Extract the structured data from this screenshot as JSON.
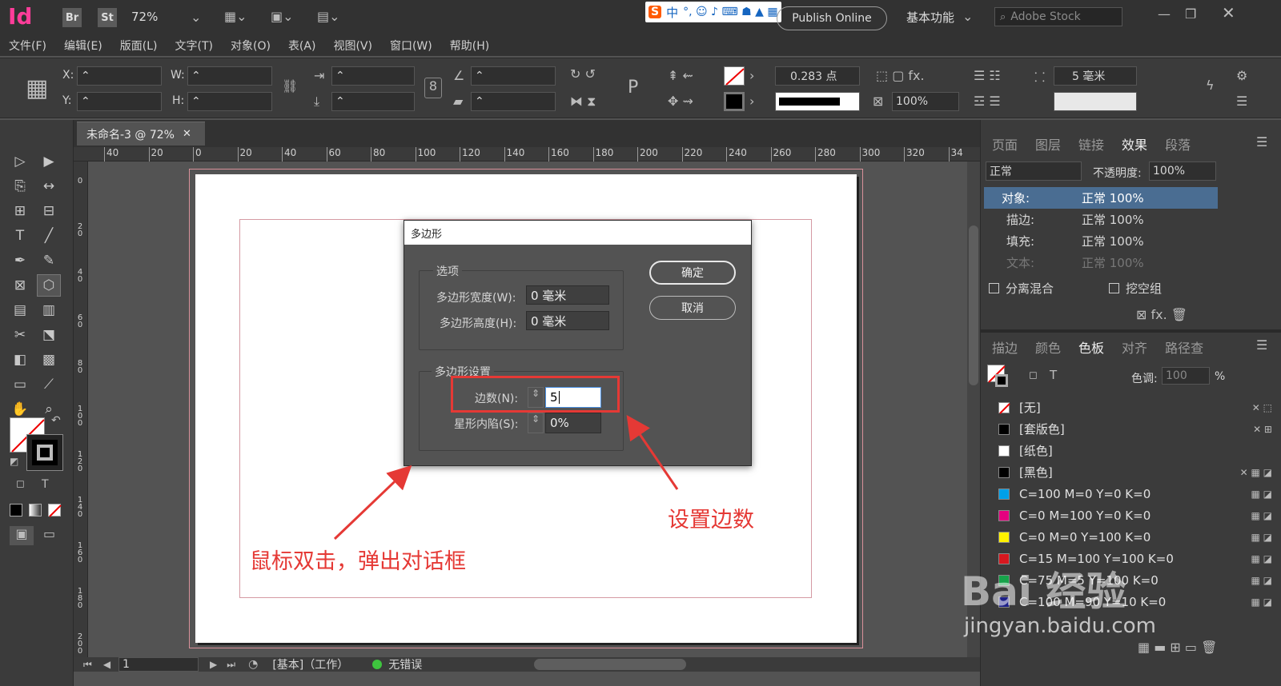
{
  "app": {
    "logo": "Id",
    "bridge": "Br",
    "stock_btn": "St",
    "zoom": "72%",
    "publish": "Publish Online",
    "workspace": "基本功能",
    "search_placeholder": "Adobe Stock"
  },
  "menu": [
    "文件(F)",
    "编辑(E)",
    "版面(L)",
    "文字(T)",
    "对象(O)",
    "表(A)",
    "视图(V)",
    "窗口(W)",
    "帮助(H)"
  ],
  "control": {
    "x_label": "X:",
    "y_label": "Y:",
    "w_label": "W:",
    "h_label": "H:",
    "stroke_weight": "0.283 点",
    "opacity": "100%",
    "gap": "5 毫米"
  },
  "document": {
    "tab_title": "未命名-3 @ 72%",
    "ruler_ticks": [
      "40",
      "20",
      "0",
      "20",
      "40",
      "60",
      "80",
      "100",
      "120",
      "140",
      "160",
      "180",
      "200",
      "220",
      "240",
      "260",
      "280",
      "300",
      "320",
      "34"
    ],
    "vruler_ticks": [
      "0",
      "2 0",
      "4 0",
      "6 0",
      "8 0",
      "1 0 0",
      "1 2 0",
      "1 4 0",
      "1 6 0",
      "1 8 0",
      "2 0 0"
    ]
  },
  "status": {
    "page": "1",
    "style": "[基本]（工作）",
    "preflight": "无错误"
  },
  "dialog": {
    "title": "多边形",
    "options_group": "选项",
    "width_label": "多边形宽度(W):",
    "width_value": "0 毫米",
    "height_label": "多边形高度(H):",
    "height_value": "0 毫米",
    "settings_group": "多边形设置",
    "sides_label": "边数(N):",
    "sides_value": "5",
    "inset_label": "星形内陷(S):",
    "inset_value": "0%",
    "ok": "确定",
    "cancel": "取消"
  },
  "effects_panel": {
    "tabs": [
      "页面",
      "图层",
      "链接",
      "效果",
      "段落"
    ],
    "blend_mode": "正常",
    "opacity_label": "不透明度:",
    "opacity_value": "100%",
    "rows": [
      {
        "name": "对象:",
        "value": "正常 100%"
      },
      {
        "name": "描边:",
        "value": "正常 100%"
      },
      {
        "name": "填充:",
        "value": "正常 100%"
      },
      {
        "name": "文本:",
        "value": "正常 100%"
      }
    ],
    "isolate": "分离混合",
    "knockout": "挖空组"
  },
  "swatches_panel": {
    "tabs": [
      "描边",
      "颜色",
      "色板",
      "对齐",
      "路径查"
    ],
    "tint_label": "色调:",
    "tint_value": "100",
    "tint_unit": "%",
    "swatches": [
      {
        "name": "[无]",
        "color": "none"
      },
      {
        "name": "[套版色]",
        "color": "#000000"
      },
      {
        "name": "[纸色]",
        "color": "#ffffff"
      },
      {
        "name": "[黑色]",
        "color": "#000000"
      },
      {
        "name": "C=100 M=0 Y=0 K=0",
        "color": "#00a0e9"
      },
      {
        "name": "C=0 M=100 Y=0 K=0",
        "color": "#e4007f"
      },
      {
        "name": "C=0 M=0 Y=100 K=0",
        "color": "#fff100"
      },
      {
        "name": "C=15 M=100 Y=100 K=0",
        "color": "#d7181f"
      },
      {
        "name": "C=75 M=5 Y=100 K=0",
        "color": "#16a34a"
      },
      {
        "name": "C=100 M=90 Y=10 K=0",
        "color": "#1d2088"
      }
    ]
  },
  "annotations": {
    "left": "鼠标双击，弹出对话框",
    "right": "设置边数"
  },
  "watermark": {
    "brand": "Bai 经验",
    "url": "jingyan.baidu.com"
  },
  "ime": {
    "zh": "中"
  }
}
